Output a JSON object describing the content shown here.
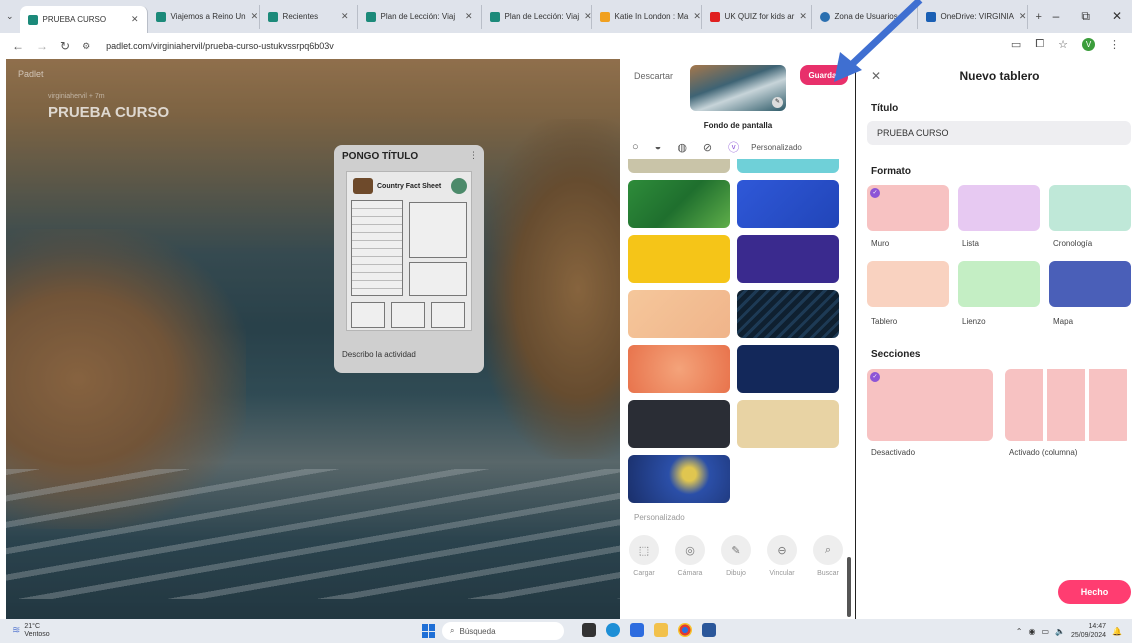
{
  "browser": {
    "tabs": [
      {
        "label": "PRUEBA CURSO",
        "color": "#1c8a7a",
        "active": true
      },
      {
        "label": "Viajemos a Reino Un",
        "color": "#1c8a7a"
      },
      {
        "label": "Recientes",
        "color": "#1c8a7a"
      },
      {
        "label": "Plan de Lección: Viaj",
        "color": "#1c8a7a"
      },
      {
        "label": "Plan de Lección: Viaj",
        "color": "#1c8a7a"
      },
      {
        "label": "Katie In London : Ma",
        "color": "#f0a020"
      },
      {
        "label": "UK QUIZ for kids ar",
        "color": "#e02020"
      },
      {
        "label": "Zona de Usuarios",
        "color": "#2a6fb0"
      },
      {
        "label": "OneDrive: VIRGINIA",
        "color": "#1a5fb4"
      }
    ],
    "new_tab": "+",
    "url": "padlet.com/virginiahervil/prueba-curso-ustukvssrpq6b03v",
    "profile_initial": "V"
  },
  "board": {
    "logo": "Padlet",
    "author": "virginiahervil + 7m",
    "title": "PRUEBA CURSO",
    "card": {
      "title": "PONGO TÍTULO",
      "sheet_title": "Country Fact Sheet",
      "caption": "Describo la actividad"
    }
  },
  "picker": {
    "discard": "Descartar",
    "save": "Guardar",
    "wallpaper_label": "Fondo de pantalla",
    "custom_filter": "Personalizado",
    "section_label": "Personalizado",
    "tools": [
      {
        "icon": "upload-icon",
        "glyph": "⬚",
        "label": "Cargar"
      },
      {
        "icon": "camera-icon",
        "glyph": "◎",
        "label": "Cámara"
      },
      {
        "icon": "draw-icon",
        "glyph": "✎",
        "label": "Dibujo"
      },
      {
        "icon": "link-icon",
        "glyph": "⊖",
        "label": "Vincular"
      },
      {
        "icon": "image-search-icon",
        "glyph": "⌕",
        "label": "Buscar"
      }
    ]
  },
  "panel": {
    "close": "✕",
    "title": "Nuevo tablero",
    "title_label": "Título",
    "title_value": "PRUEBA CURSO",
    "format_label": "Formato",
    "formats": [
      "Muro",
      "Lista",
      "Cronología",
      "Tablero",
      "Lienzo",
      "Mapa"
    ],
    "sections_label": "Secciones",
    "sections": [
      "Desactivado",
      "Activado (columna)"
    ],
    "done": "Hecho"
  },
  "taskbar": {
    "temp": "21°C",
    "weather": "Ventoso",
    "search_placeholder": "Búsqueda",
    "time": "14:47",
    "date": "25/09/2024"
  },
  "colors": {
    "accent": "#e8306b",
    "done": "#ff3d71",
    "selected": "#8d55d6",
    "annotation_arrow": "#3f6fd1"
  }
}
